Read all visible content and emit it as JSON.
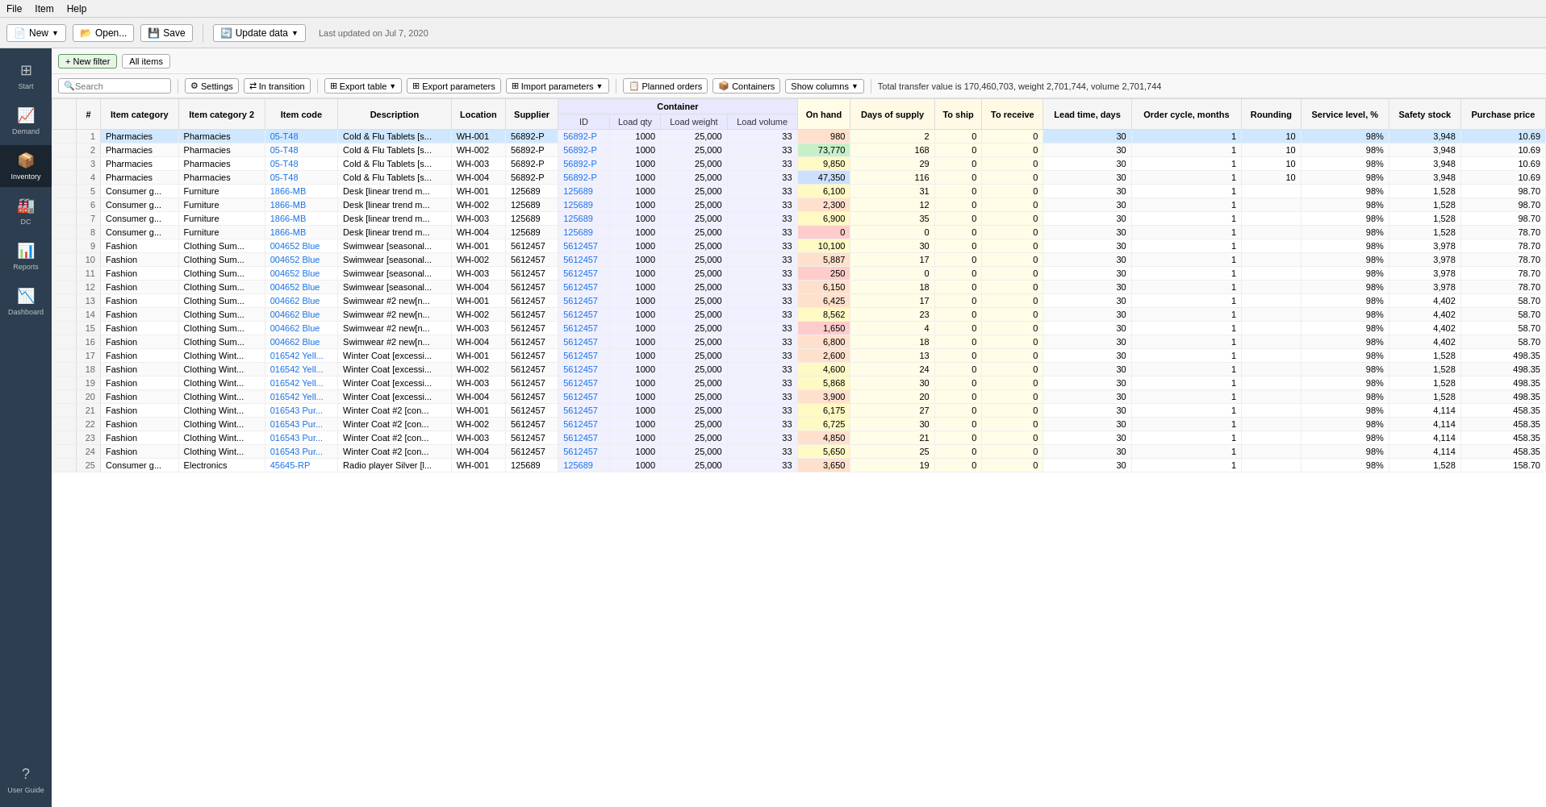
{
  "menuBar": {
    "items": [
      "File",
      "Item",
      "Help"
    ]
  },
  "toolbar": {
    "newLabel": "New",
    "openLabel": "Open...",
    "saveLabel": "Save",
    "updateLabel": "Update data",
    "lastUpdated": "Last updated on Jul 7, 2020"
  },
  "sidebar": {
    "items": [
      {
        "label": "Start",
        "icon": "⊞"
      },
      {
        "label": "Demand",
        "icon": "📈"
      },
      {
        "label": "Inventory",
        "icon": "📦"
      },
      {
        "label": "DC",
        "icon": "🏭"
      },
      {
        "label": "Reports",
        "icon": "📊"
      },
      {
        "label": "Dashboard",
        "icon": "📉"
      }
    ],
    "bottom": {
      "label": "User Guide",
      "icon": "?"
    }
  },
  "filterBar": {
    "newFilterLabel": "+ New filter",
    "allItemsLabel": "All items"
  },
  "searchBar": {
    "placeholder": "Search"
  },
  "actionBar": {
    "settingsLabel": "Settings",
    "inTransitionLabel": "In transition",
    "exportTableLabel": "Export table",
    "exportParamsLabel": "Export parameters",
    "importParamsLabel": "Import parameters",
    "plannedOrdersLabel": "Planned orders",
    "containersLabel": "Containers",
    "showColumnsLabel": "Show columns",
    "totalText": "Total transfer value is 170,460,703, weight 2,701,744, volume 2,701,744"
  },
  "tableHeaders": {
    "row1": [
      "",
      "#",
      "Item category",
      "Item category 2",
      "Item code",
      "Description",
      "Location",
      "Supplier",
      "Container",
      "",
      "",
      "On hand",
      "Days of supply",
      "To ship",
      "To receive",
      "Lead time, days",
      "Order cycle, months",
      "Rounding",
      "Service level, %",
      "Safety stock",
      "Purchase price"
    ],
    "containerSubHeaders": [
      "ID",
      "Load qty",
      "Load weight",
      "Load volume"
    ]
  },
  "rows": [
    {
      "num": 1,
      "cat": "Pharmacies",
      "cat2": "Pharmacies",
      "code": "05-T48",
      "desc": "Cold & Flu Tablets [s...",
      "loc": "WH-001",
      "supp": "56892-P",
      "contId": "56892-P",
      "loadQty": 1000,
      "loadWt": "25,000",
      "loadVol": 33,
      "onhand": 980,
      "daysSupply": 2,
      "toShip": 0,
      "toReceive": 0,
      "leadTime": 30,
      "orderCycle": 1,
      "rounding": 10,
      "serviceLevel": "98%",
      "safetyStock": 3948,
      "purchPrice": "10.69",
      "onhandClass": "onhand-orange"
    },
    {
      "num": 2,
      "cat": "Pharmacies",
      "cat2": "Pharmacies",
      "code": "05-T48",
      "desc": "Cold & Flu Tablets [s...",
      "loc": "WH-002",
      "supp": "56892-P",
      "contId": "56892-P",
      "loadQty": 1000,
      "loadWt": "25,000",
      "loadVol": 33,
      "onhand": 73770,
      "daysSupply": 168,
      "toShip": 0,
      "toReceive": 0,
      "leadTime": 30,
      "orderCycle": 1,
      "rounding": 10,
      "serviceLevel": "98%",
      "safetyStock": 3948,
      "purchPrice": "10.69",
      "onhandClass": "onhand-green"
    },
    {
      "num": 3,
      "cat": "Pharmacies",
      "cat2": "Pharmacies",
      "code": "05-T48",
      "desc": "Cold & Flu Tablets [s...",
      "loc": "WH-003",
      "supp": "56892-P",
      "contId": "56892-P",
      "loadQty": 1000,
      "loadWt": "25,000",
      "loadVol": 33,
      "onhand": 9850,
      "daysSupply": 29,
      "toShip": 0,
      "toReceive": 0,
      "leadTime": 30,
      "orderCycle": 1,
      "rounding": 10,
      "serviceLevel": "98%",
      "safetyStock": 3948,
      "purchPrice": "10.69",
      "onhandClass": "onhand-yellow"
    },
    {
      "num": 4,
      "cat": "Pharmacies",
      "cat2": "Pharmacies",
      "code": "05-T48",
      "desc": "Cold & Flu Tablets [s...",
      "loc": "WH-004",
      "supp": "56892-P",
      "contId": "56892-P",
      "loadQty": 1000,
      "loadWt": "25,000",
      "loadVol": 33,
      "onhand": 47350,
      "daysSupply": 116,
      "toShip": 0,
      "toReceive": 0,
      "leadTime": 30,
      "orderCycle": 1,
      "rounding": 10,
      "serviceLevel": "98%",
      "safetyStock": 3948,
      "purchPrice": "10.69",
      "onhandClass": "onhand-blue"
    },
    {
      "num": 5,
      "cat": "Consumer g...",
      "cat2": "Furniture",
      "code": "1866-MB",
      "desc": "Desk [linear trend m...",
      "loc": "WH-001",
      "supp": "125689",
      "contId": "125689",
      "loadQty": 1000,
      "loadWt": "25,000",
      "loadVol": 33,
      "onhand": 6100,
      "daysSupply": 31,
      "toShip": 0,
      "toReceive": 0,
      "leadTime": 30,
      "orderCycle": 1,
      "rounding": "",
      "serviceLevel": "98%",
      "safetyStock": 1528,
      "purchPrice": "98.70",
      "onhandClass": "onhand-yellow"
    },
    {
      "num": 6,
      "cat": "Consumer g...",
      "cat2": "Furniture",
      "code": "1866-MB",
      "desc": "Desk [linear trend m...",
      "loc": "WH-002",
      "supp": "125689",
      "contId": "125689",
      "loadQty": 1000,
      "loadWt": "25,000",
      "loadVol": 33,
      "onhand": 2300,
      "daysSupply": 12,
      "toShip": 0,
      "toReceive": 0,
      "leadTime": 30,
      "orderCycle": 1,
      "rounding": "",
      "serviceLevel": "98%",
      "safetyStock": 1528,
      "purchPrice": "98.70",
      "onhandClass": "onhand-orange"
    },
    {
      "num": 7,
      "cat": "Consumer g...",
      "cat2": "Furniture",
      "code": "1866-MB",
      "desc": "Desk [linear trend m...",
      "loc": "WH-003",
      "supp": "125689",
      "contId": "125689",
      "loadQty": 1000,
      "loadWt": "25,000",
      "loadVol": 33,
      "onhand": 6900,
      "daysSupply": 35,
      "toShip": 0,
      "toReceive": 0,
      "leadTime": 30,
      "orderCycle": 1,
      "rounding": "",
      "serviceLevel": "98%",
      "safetyStock": 1528,
      "purchPrice": "98.70",
      "onhandClass": "onhand-yellow"
    },
    {
      "num": 8,
      "cat": "Consumer g...",
      "cat2": "Furniture",
      "code": "1866-MB",
      "desc": "Desk [linear trend m...",
      "loc": "WH-004",
      "supp": "125689",
      "contId": "125689",
      "loadQty": 1000,
      "loadWt": "25,000",
      "loadVol": 33,
      "onhand": 0,
      "daysSupply": 0,
      "toShip": 0,
      "toReceive": 0,
      "leadTime": 30,
      "orderCycle": 1,
      "rounding": "",
      "serviceLevel": "98%",
      "safetyStock": 1528,
      "purchPrice": "78.70",
      "onhandClass": "onhand-red"
    },
    {
      "num": 9,
      "cat": "Fashion",
      "cat2": "Clothing Sum...",
      "code": "004652 Blue",
      "desc": "Swimwear [seasonal...",
      "loc": "WH-001",
      "supp": "5612457",
      "contId": "5612457",
      "loadQty": 1000,
      "loadWt": "25,000",
      "loadVol": 33,
      "onhand": 10100,
      "daysSupply": 30,
      "toShip": 0,
      "toReceive": 0,
      "leadTime": 30,
      "orderCycle": 1,
      "rounding": "",
      "serviceLevel": "98%",
      "safetyStock": 3978,
      "purchPrice": "78.70",
      "onhandClass": "onhand-yellow"
    },
    {
      "num": 10,
      "cat": "Fashion",
      "cat2": "Clothing Sum...",
      "code": "004652 Blue",
      "desc": "Swimwear [seasonal...",
      "loc": "WH-002",
      "supp": "5612457",
      "contId": "5612457",
      "loadQty": 1000,
      "loadWt": "25,000",
      "loadVol": 33,
      "onhand": 5887,
      "daysSupply": 17,
      "toShip": 0,
      "toReceive": 0,
      "leadTime": 30,
      "orderCycle": 1,
      "rounding": "",
      "serviceLevel": "98%",
      "safetyStock": 3978,
      "purchPrice": "78.70",
      "onhandClass": "onhand-orange"
    },
    {
      "num": 11,
      "cat": "Fashion",
      "cat2": "Clothing Sum...",
      "code": "004652 Blue",
      "desc": "Swimwear [seasonal...",
      "loc": "WH-003",
      "supp": "5612457",
      "contId": "5612457",
      "loadQty": 1000,
      "loadWt": "25,000",
      "loadVol": 33,
      "onhand": 250,
      "daysSupply": 0,
      "toShip": 0,
      "toReceive": 0,
      "leadTime": 30,
      "orderCycle": 1,
      "rounding": "",
      "serviceLevel": "98%",
      "safetyStock": 3978,
      "purchPrice": "78.70",
      "onhandClass": "onhand-red"
    },
    {
      "num": 12,
      "cat": "Fashion",
      "cat2": "Clothing Sum...",
      "code": "004652 Blue",
      "desc": "Swimwear [seasonal...",
      "loc": "WH-004",
      "supp": "5612457",
      "contId": "5612457",
      "loadQty": 1000,
      "loadWt": "25,000",
      "loadVol": 33,
      "onhand": 6150,
      "daysSupply": 18,
      "toShip": 0,
      "toReceive": 0,
      "leadTime": 30,
      "orderCycle": 1,
      "rounding": "",
      "serviceLevel": "98%",
      "safetyStock": 3978,
      "purchPrice": "78.70",
      "onhandClass": "onhand-orange"
    },
    {
      "num": 13,
      "cat": "Fashion",
      "cat2": "Clothing Sum...",
      "code": "004662 Blue",
      "desc": "Swimwear #2 new[n...",
      "loc": "WH-001",
      "supp": "5612457",
      "contId": "5612457",
      "loadQty": 1000,
      "loadWt": "25,000",
      "loadVol": 33,
      "onhand": 6425,
      "daysSupply": 17,
      "toShip": 0,
      "toReceive": 0,
      "leadTime": 30,
      "orderCycle": 1,
      "rounding": "",
      "serviceLevel": "98%",
      "safetyStock": 4402,
      "purchPrice": "58.70",
      "onhandClass": "onhand-orange"
    },
    {
      "num": 14,
      "cat": "Fashion",
      "cat2": "Clothing Sum...",
      "code": "004662 Blue",
      "desc": "Swimwear #2 new[n...",
      "loc": "WH-002",
      "supp": "5612457",
      "contId": "5612457",
      "loadQty": 1000,
      "loadWt": "25,000",
      "loadVol": 33,
      "onhand": 8562,
      "daysSupply": 23,
      "toShip": 0,
      "toReceive": 0,
      "leadTime": 30,
      "orderCycle": 1,
      "rounding": "",
      "serviceLevel": "98%",
      "safetyStock": 4402,
      "purchPrice": "58.70",
      "onhandClass": "onhand-yellow"
    },
    {
      "num": 15,
      "cat": "Fashion",
      "cat2": "Clothing Sum...",
      "code": "004662 Blue",
      "desc": "Swimwear #2 new[n...",
      "loc": "WH-003",
      "supp": "5612457",
      "contId": "5612457",
      "loadQty": 1000,
      "loadWt": "25,000",
      "loadVol": 33,
      "onhand": 1650,
      "daysSupply": 4,
      "toShip": 0,
      "toReceive": 0,
      "leadTime": 30,
      "orderCycle": 1,
      "rounding": "",
      "serviceLevel": "98%",
      "safetyStock": 4402,
      "purchPrice": "58.70",
      "onhandClass": "onhand-red"
    },
    {
      "num": 16,
      "cat": "Fashion",
      "cat2": "Clothing Sum...",
      "code": "004662 Blue",
      "desc": "Swimwear #2 new[n...",
      "loc": "WH-004",
      "supp": "5612457",
      "contId": "5612457",
      "loadQty": 1000,
      "loadWt": "25,000",
      "loadVol": 33,
      "onhand": 6800,
      "daysSupply": 18,
      "toShip": 0,
      "toReceive": 0,
      "leadTime": 30,
      "orderCycle": 1,
      "rounding": "",
      "serviceLevel": "98%",
      "safetyStock": 4402,
      "purchPrice": "58.70",
      "onhandClass": "onhand-orange"
    },
    {
      "num": 17,
      "cat": "Fashion",
      "cat2": "Clothing Wint...",
      "code": "016542 Yell...",
      "desc": "Winter Coat [excessi...",
      "loc": "WH-001",
      "supp": "5612457",
      "contId": "5612457",
      "loadQty": 1000,
      "loadWt": "25,000",
      "loadVol": 33,
      "onhand": 2600,
      "daysSupply": 13,
      "toShip": 0,
      "toReceive": 0,
      "leadTime": 30,
      "orderCycle": 1,
      "rounding": "",
      "serviceLevel": "98%",
      "safetyStock": 1528,
      "purchPrice": "498.35",
      "onhandClass": "onhand-orange"
    },
    {
      "num": 18,
      "cat": "Fashion",
      "cat2": "Clothing Wint...",
      "code": "016542 Yell...",
      "desc": "Winter Coat [excessi...",
      "loc": "WH-002",
      "supp": "5612457",
      "contId": "5612457",
      "loadQty": 1000,
      "loadWt": "25,000",
      "loadVol": 33,
      "onhand": 4600,
      "daysSupply": 24,
      "toShip": 0,
      "toReceive": 0,
      "leadTime": 30,
      "orderCycle": 1,
      "rounding": "",
      "serviceLevel": "98%",
      "safetyStock": 1528,
      "purchPrice": "498.35",
      "onhandClass": "onhand-yellow"
    },
    {
      "num": 19,
      "cat": "Fashion",
      "cat2": "Clothing Wint...",
      "code": "016542 Yell...",
      "desc": "Winter Coat [excessi...",
      "loc": "WH-003",
      "supp": "5612457",
      "contId": "5612457",
      "loadQty": 1000,
      "loadWt": "25,000",
      "loadVol": 33,
      "onhand": 5868,
      "daysSupply": 30,
      "toShip": 0,
      "toReceive": 0,
      "leadTime": 30,
      "orderCycle": 1,
      "rounding": "",
      "serviceLevel": "98%",
      "safetyStock": 1528,
      "purchPrice": "498.35",
      "onhandClass": "onhand-yellow"
    },
    {
      "num": 20,
      "cat": "Fashion",
      "cat2": "Clothing Wint...",
      "code": "016542 Yell...",
      "desc": "Winter Coat [excessi...",
      "loc": "WH-004",
      "supp": "5612457",
      "contId": "5612457",
      "loadQty": 1000,
      "loadWt": "25,000",
      "loadVol": 33,
      "onhand": 3900,
      "daysSupply": 20,
      "toShip": 0,
      "toReceive": 0,
      "leadTime": 30,
      "orderCycle": 1,
      "rounding": "",
      "serviceLevel": "98%",
      "safetyStock": 1528,
      "purchPrice": "498.35",
      "onhandClass": "onhand-orange"
    },
    {
      "num": 21,
      "cat": "Fashion",
      "cat2": "Clothing Wint...",
      "code": "016543 Pur...",
      "desc": "Winter Coat #2 [con...",
      "loc": "WH-001",
      "supp": "5612457",
      "contId": "5612457",
      "loadQty": 1000,
      "loadWt": "25,000",
      "loadVol": 33,
      "onhand": 6175,
      "daysSupply": 27,
      "toShip": 0,
      "toReceive": 0,
      "leadTime": 30,
      "orderCycle": 1,
      "rounding": "",
      "serviceLevel": "98%",
      "safetyStock": 4114,
      "purchPrice": "458.35",
      "onhandClass": "onhand-yellow"
    },
    {
      "num": 22,
      "cat": "Fashion",
      "cat2": "Clothing Wint...",
      "code": "016543 Pur...",
      "desc": "Winter Coat #2 [con...",
      "loc": "WH-002",
      "supp": "5612457",
      "contId": "5612457",
      "loadQty": 1000,
      "loadWt": "25,000",
      "loadVol": 33,
      "onhand": 6725,
      "daysSupply": 30,
      "toShip": 0,
      "toReceive": 0,
      "leadTime": 30,
      "orderCycle": 1,
      "rounding": "",
      "serviceLevel": "98%",
      "safetyStock": 4114,
      "purchPrice": "458.35",
      "onhandClass": "onhand-yellow"
    },
    {
      "num": 23,
      "cat": "Fashion",
      "cat2": "Clothing Wint...",
      "code": "016543 Pur...",
      "desc": "Winter Coat #2 [con...",
      "loc": "WH-003",
      "supp": "5612457",
      "contId": "5612457",
      "loadQty": 1000,
      "loadWt": "25,000",
      "loadVol": 33,
      "onhand": 4850,
      "daysSupply": 21,
      "toShip": 0,
      "toReceive": 0,
      "leadTime": 30,
      "orderCycle": 1,
      "rounding": "",
      "serviceLevel": "98%",
      "safetyStock": 4114,
      "purchPrice": "458.35",
      "onhandClass": "onhand-orange"
    },
    {
      "num": 24,
      "cat": "Fashion",
      "cat2": "Clothing Wint...",
      "code": "016543 Pur...",
      "desc": "Winter Coat #2 [con...",
      "loc": "WH-004",
      "supp": "5612457",
      "contId": "5612457",
      "loadQty": 1000,
      "loadWt": "25,000",
      "loadVol": 33,
      "onhand": 5650,
      "daysSupply": 25,
      "toShip": 0,
      "toReceive": 0,
      "leadTime": 30,
      "orderCycle": 1,
      "rounding": "",
      "serviceLevel": "98%",
      "safetyStock": 4114,
      "purchPrice": "458.35",
      "onhandClass": "onhand-yellow"
    },
    {
      "num": 25,
      "cat": "Consumer g...",
      "cat2": "Electronics",
      "code": "45645-RP",
      "desc": "Radio player Silver [l...",
      "loc": "WH-001",
      "supp": "125689",
      "contId": "125689",
      "loadQty": 1000,
      "loadWt": "25,000",
      "loadVol": 33,
      "onhand": 3650,
      "daysSupply": 19,
      "toShip": 0,
      "toReceive": 0,
      "leadTime": 30,
      "orderCycle": 1,
      "rounding": "",
      "serviceLevel": "98%",
      "safetyStock": 1528,
      "purchPrice": "158.70",
      "onhandClass": "onhand-orange"
    }
  ]
}
